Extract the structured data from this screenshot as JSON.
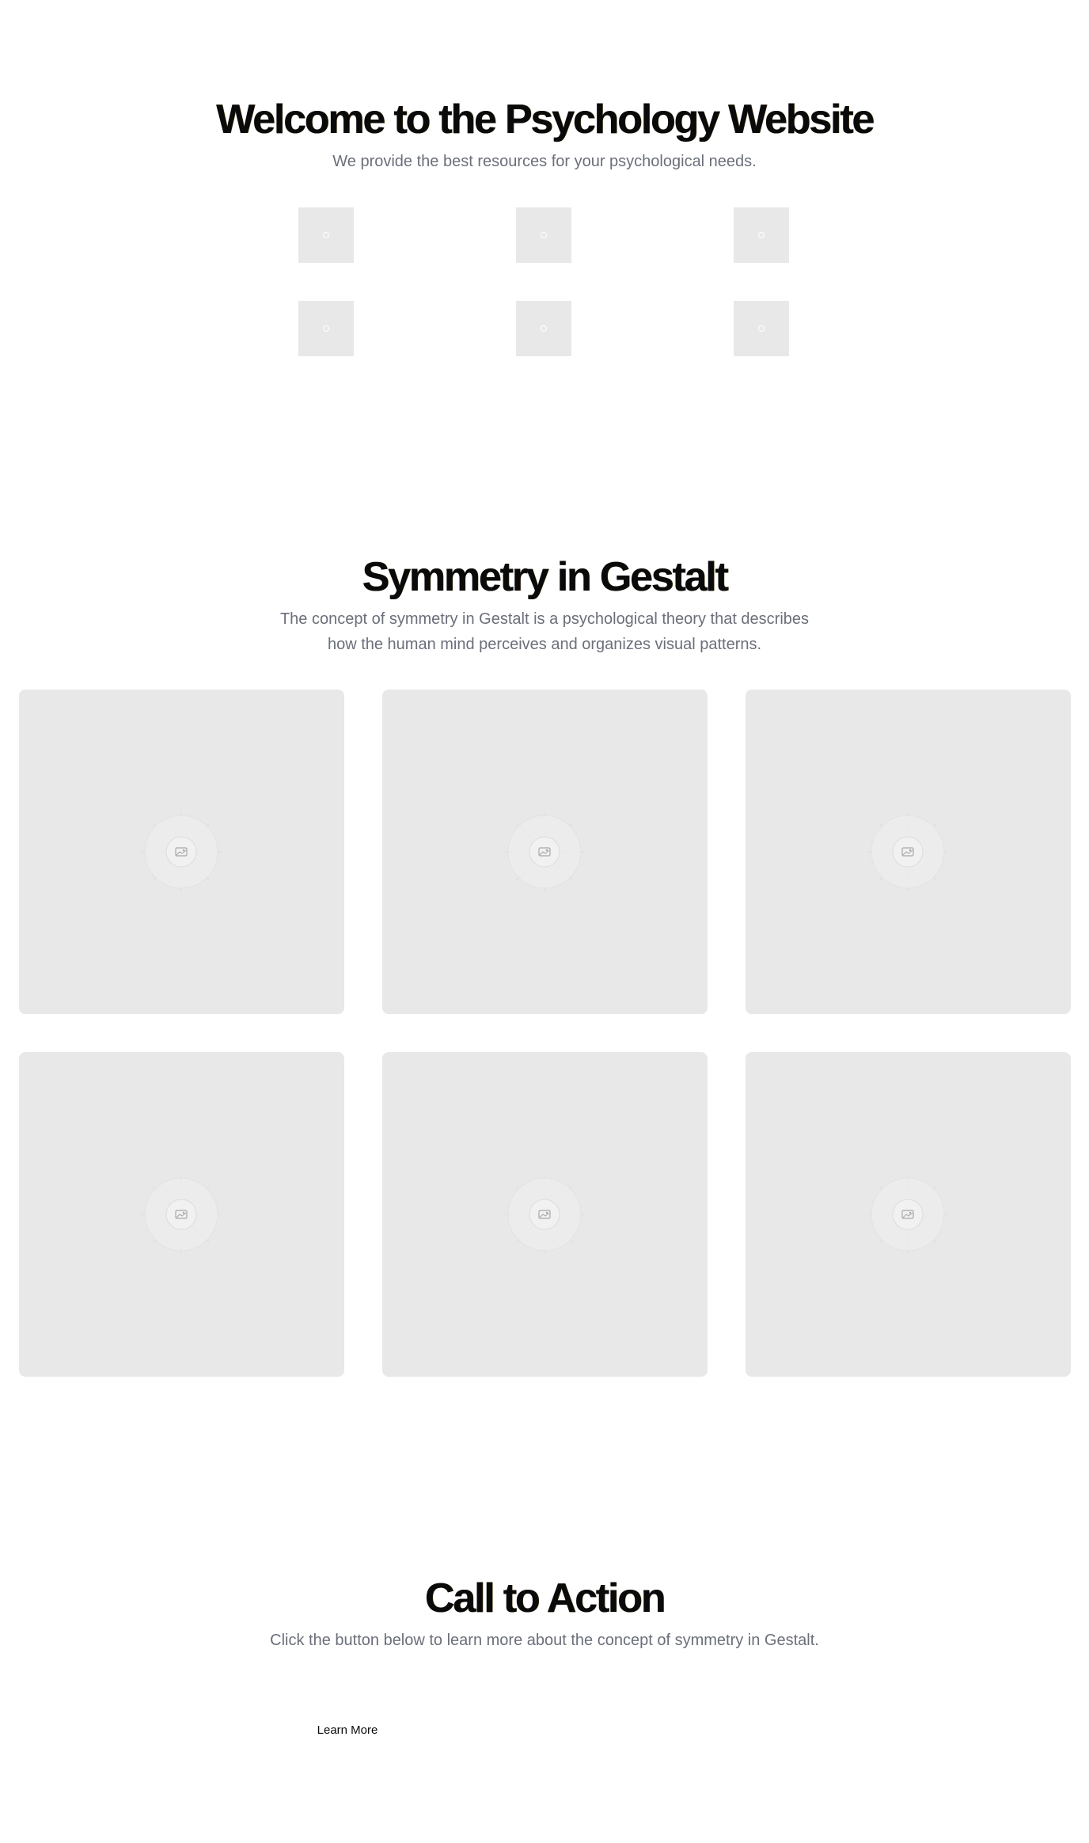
{
  "hero": {
    "title": "Welcome to the Psychology Website",
    "subtitle": "We provide the best resources for your psychological needs.",
    "thumbnails": [
      "image-placeholder",
      "image-placeholder",
      "image-placeholder",
      "image-placeholder",
      "image-placeholder",
      "image-placeholder"
    ]
  },
  "gestalt": {
    "title": "Symmetry in Gestalt",
    "subtitle": "The concept of symmetry in Gestalt is a psychological theory that describes how the human mind perceives and organizes visual patterns.",
    "cards": [
      "image-placeholder-icon",
      "image-placeholder-icon",
      "image-placeholder-icon",
      "image-placeholder-icon",
      "image-placeholder-icon",
      "image-placeholder-icon"
    ]
  },
  "cta": {
    "title": "Call to Action",
    "subtitle": "Click the button below to learn more about the concept of symmetry in Gestalt.",
    "button_label": "Learn More"
  },
  "colors": {
    "heading": "#0a0a0a",
    "body_text": "#6b6f7a",
    "placeholder_bg": "#e8e8e8",
    "page_bg": "#ffffff"
  }
}
